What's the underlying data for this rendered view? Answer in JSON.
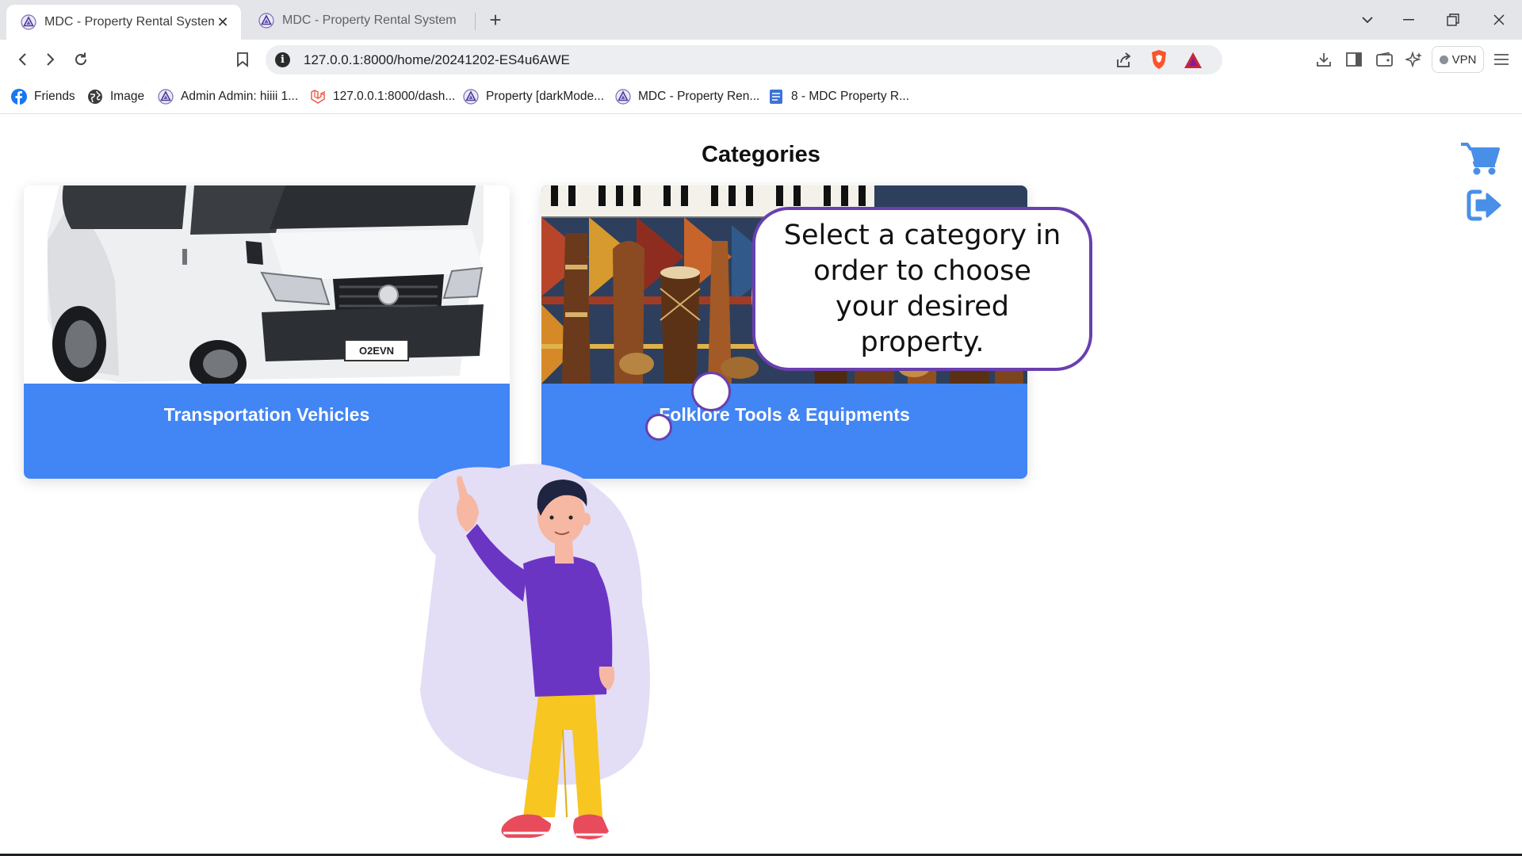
{
  "browser": {
    "tabs": [
      {
        "title": "MDC - Property Rental System",
        "active": true
      },
      {
        "title": "MDC - Property Rental System",
        "active": false
      }
    ],
    "url": "127.0.0.1:8000/home/20241202-ES4u6AWE",
    "vpn_label": "VPN",
    "bookmarks": [
      {
        "label": "Friends",
        "icon": "facebook-icon"
      },
      {
        "label": "Image",
        "icon": "globe-icon"
      },
      {
        "label": "Admin Admin: hiiii 1...",
        "icon": "app-logo-icon"
      },
      {
        "label": "127.0.0.1:8000/dash...",
        "icon": "laravel-icon"
      },
      {
        "label": "Property [darkMode...",
        "icon": "app-logo-icon"
      },
      {
        "label": "MDC - Property Ren...",
        "icon": "app-logo-icon"
      },
      {
        "label": "8 - MDC Property R...",
        "icon": "document-icon"
      }
    ]
  },
  "page": {
    "title": "Categories",
    "categories": [
      {
        "label": "Transportation Vehicles",
        "image": "white-van"
      },
      {
        "label": "Folklore Tools & Equipments",
        "image": "folk-instruments"
      }
    ],
    "bubble_text": "Select a category in order to choose your desired property.",
    "side_icons": [
      "cart-icon",
      "logout-icon"
    ]
  },
  "colors": {
    "accent": "#4285f4",
    "bubble_border": "#6a3fae",
    "icon_blue": "#4a8fe7",
    "character_shirt": "#6b35c4",
    "character_pants": "#f7c621",
    "blob": "#e4ddf6"
  }
}
